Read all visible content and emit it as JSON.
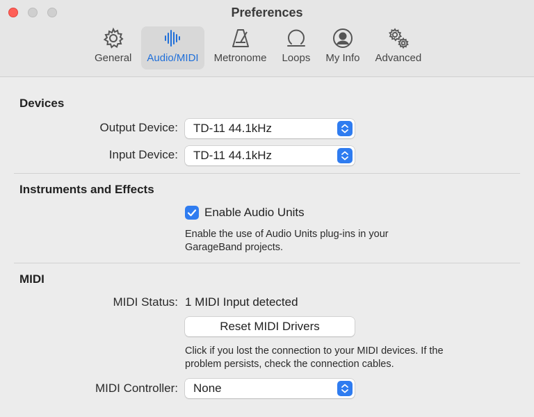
{
  "window": {
    "title": "Preferences"
  },
  "toolbar": {
    "tabs": [
      {
        "label": "General",
        "icon": "gear-icon"
      },
      {
        "label": "Audio/MIDI",
        "icon": "waveform-icon",
        "active": true
      },
      {
        "label": "Metronome",
        "icon": "metronome-icon"
      },
      {
        "label": "Loops",
        "icon": "loop-icon"
      },
      {
        "label": "My Info",
        "icon": "person-icon"
      },
      {
        "label": "Advanced",
        "icon": "gears-icon"
      }
    ]
  },
  "devices": {
    "heading": "Devices",
    "output_label": "Output Device:",
    "output_value": "TD-11 44.1kHz",
    "input_label": "Input Device:",
    "input_value": "TD-11 44.1kHz"
  },
  "instruments": {
    "heading": "Instruments and Effects",
    "checkbox_label": "Enable Audio Units",
    "checkbox_checked": true,
    "description_line1": "Enable the use of Audio Units plug-ins in your",
    "description_line2": "GarageBand projects."
  },
  "midi": {
    "heading": "MIDI",
    "status_label": "MIDI Status:",
    "status_value": "1 MIDI Input detected",
    "reset_button": "Reset MIDI Drivers",
    "help_line1": "Click if you lost the connection to your MIDI devices. If the",
    "help_line2": "problem persists, check the connection cables.",
    "controller_label": "MIDI Controller:",
    "controller_value": "None"
  },
  "colors": {
    "accent": "#2f7cf0",
    "active_tab_label": "#1f6fd9",
    "close_button": "#fe5f57"
  }
}
